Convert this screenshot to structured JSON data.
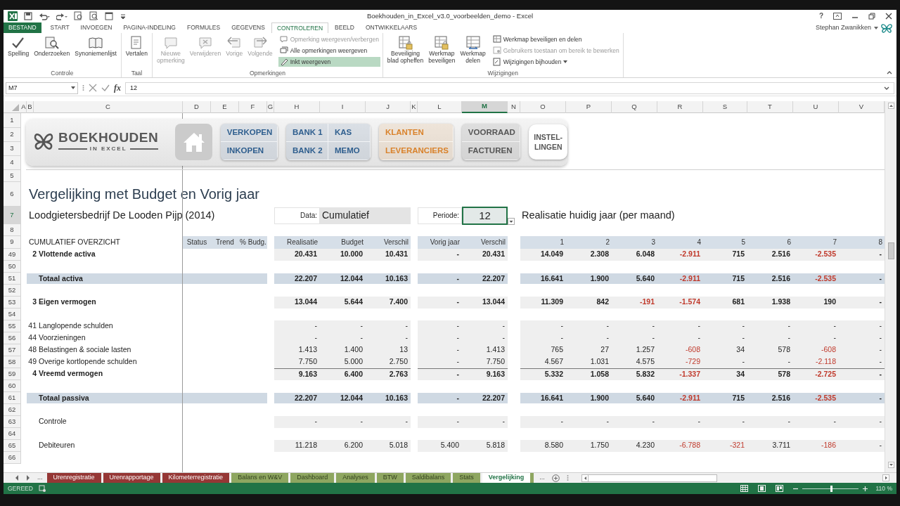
{
  "window": {
    "title": "Boekhouden_in_Excel_v3.0_voorbeelden_demo - Excel",
    "help": "?",
    "user": "Stephan Zwanikken"
  },
  "ribbon_tabs": [
    {
      "label": "BESTAND",
      "kind": "file",
      "selected": false
    },
    {
      "label": "START",
      "kind": "tab",
      "selected": false
    },
    {
      "label": "INVOEGEN",
      "kind": "tab",
      "selected": false
    },
    {
      "label": "PAGINA-INDELING",
      "kind": "tab",
      "selected": false
    },
    {
      "label": "FORMULES",
      "kind": "tab",
      "selected": false
    },
    {
      "label": "GEGEVENS",
      "kind": "tab",
      "selected": false
    },
    {
      "label": "CONTROLEREN",
      "kind": "tab",
      "selected": true
    },
    {
      "label": "BEELD",
      "kind": "tab",
      "selected": false
    },
    {
      "label": "ONTWIKKELAARS",
      "kind": "tab",
      "selected": false
    }
  ],
  "ribbon_groups": [
    {
      "label": "Controle",
      "commands": [
        {
          "label": "Spelling",
          "kind": "large",
          "disabled": false,
          "on": false,
          "dropdown": false
        },
        {
          "label": "Onderzoeken",
          "kind": "large",
          "disabled": false,
          "on": false,
          "dropdown": false
        },
        {
          "label": "Synoniemenlijst",
          "kind": "large",
          "disabled": false,
          "on": false,
          "dropdown": false
        }
      ]
    },
    {
      "label": "Taal",
      "commands": [
        {
          "label": "Vertalen",
          "kind": "large",
          "disabled": false,
          "on": false,
          "dropdown": false
        }
      ]
    },
    {
      "label": "Opmerkingen",
      "commands": [
        {
          "label": "Nieuwe\nopmerking",
          "kind": "large",
          "disabled": true,
          "on": false,
          "dropdown": false
        },
        {
          "label": "Verwijderen",
          "kind": "large",
          "disabled": true,
          "on": false,
          "dropdown": false
        },
        {
          "label": "Vorige",
          "kind": "large",
          "disabled": true,
          "on": false,
          "dropdown": false
        },
        {
          "label": "Volgende",
          "kind": "large",
          "disabled": true,
          "on": false,
          "dropdown": false
        },
        {
          "label": "Opmerking weergeven/verbergen",
          "kind": "small",
          "disabled": true,
          "on": false,
          "dropdown": false
        },
        {
          "label": "Alle opmerkingen weergeven",
          "kind": "small",
          "disabled": false,
          "on": false,
          "dropdown": false
        },
        {
          "label": "Inkt weergeven",
          "kind": "small",
          "disabled": false,
          "on": true,
          "dropdown": false
        }
      ]
    },
    {
      "label": "Wijzigingen",
      "commands": [
        {
          "label": "Beveiliging\nblad opheffen",
          "kind": "large",
          "disabled": false,
          "on": false,
          "dropdown": false
        },
        {
          "label": "Werkmap\nbeveiligen",
          "kind": "large",
          "disabled": false,
          "on": false,
          "dropdown": false
        },
        {
          "label": "Werkmap\ndelen",
          "kind": "large",
          "disabled": false,
          "on": false,
          "dropdown": false
        },
        {
          "label": "Werkmap beveiligen en delen",
          "kind": "small",
          "disabled": false,
          "on": false,
          "dropdown": false
        },
        {
          "label": "Gebruikers toestaan om bereik te bewerken",
          "kind": "small",
          "disabled": true,
          "on": false,
          "dropdown": false
        },
        {
          "label": "Wijzigingen bijhouden",
          "kind": "small",
          "disabled": false,
          "on": false,
          "dropdown": true
        }
      ]
    }
  ],
  "formula_bar": {
    "name_box": "M7",
    "function_label": "fx",
    "formula": "12"
  },
  "columns": [
    {
      "label": "A",
      "selected": false
    },
    {
      "label": "B",
      "selected": false
    },
    {
      "label": "C",
      "selected": false
    },
    {
      "label": "D",
      "selected": false
    },
    {
      "label": "E",
      "selected": false
    },
    {
      "label": "F",
      "selected": false
    },
    {
      "label": "G",
      "selected": false
    },
    {
      "label": "H",
      "selected": false
    },
    {
      "label": "I",
      "selected": false
    },
    {
      "label": "J",
      "selected": false
    },
    {
      "label": "K",
      "selected": false
    },
    {
      "label": "L",
      "selected": false
    },
    {
      "label": "M",
      "selected": true
    },
    {
      "label": "N",
      "selected": false
    },
    {
      "label": "O",
      "selected": false
    },
    {
      "label": "P",
      "selected": false
    },
    {
      "label": "Q",
      "selected": false
    },
    {
      "label": "R",
      "selected": false
    },
    {
      "label": "S",
      "selected": false
    },
    {
      "label": "T",
      "selected": false
    },
    {
      "label": "U",
      "selected": false
    },
    {
      "label": "V",
      "selected": false
    }
  ],
  "top_rows": [
    {
      "number": "1",
      "selected": false
    },
    {
      "number": "2",
      "selected": false
    },
    {
      "number": "3",
      "selected": false
    },
    {
      "number": "4",
      "selected": false
    },
    {
      "number": "5",
      "selected": false
    },
    {
      "number": "6",
      "selected": false
    },
    {
      "number": "7",
      "selected": true
    },
    {
      "number": "8",
      "selected": false
    },
    {
      "number": "9",
      "selected": false
    }
  ],
  "dashboard": {
    "logo": {
      "title": "BOEKHOUDEN",
      "subtitle": "IN EXCEL"
    },
    "nav_groups": [
      {
        "kind": "home"
      },
      {
        "kind": "pair",
        "color": "#2e5e8e",
        "buttons": [
          "VERKOPEN",
          "INKOPEN"
        ]
      },
      {
        "kind": "pair",
        "color": "#2e5e8e",
        "buttons": [
          "BANK 1",
          "KAS",
          "BANK 2",
          "MEMO"
        ]
      },
      {
        "kind": "pair",
        "color": "#d9822b",
        "buttons": [
          "KLANTEN",
          "LEVERANCIERS"
        ]
      },
      {
        "kind": "pair",
        "color": "#555555",
        "buttons": [
          "VOORRAAD",
          "FACTUREN"
        ]
      },
      {
        "kind": "single",
        "color": "#555555",
        "buttons": [
          "INSTEL-LINGEN"
        ]
      }
    ]
  },
  "sheet": {
    "title": "Vergelijking met Budget en Vorig jaar",
    "company": "Loodgietersbedrijf De Looden Pijp (2014)",
    "data_label": "Data:",
    "data_value": "Cumulatief",
    "period_label": "Periode:",
    "period_value": "12",
    "monthly_title": "Realisatie huidig jaar (per maand)"
  },
  "overview": {
    "title": "CUMULATIEF OVERZICHT",
    "columns": [
      "Status",
      "Trend",
      "% Budg.",
      "Realisatie",
      "Budget",
      "Verschil",
      "Vorig jaar",
      "Verschil",
      "1",
      "2",
      "3",
      "4",
      "5",
      "6",
      "7",
      "8"
    ]
  },
  "rows": [
    {
      "number": "49",
      "selected": false,
      "kind": "section",
      "code": "2",
      "label": "Vlottende activa",
      "values": [
        {
          "t": "20.431",
          "neg": false
        },
        {
          "t": "10.000",
          "neg": false
        },
        {
          "t": "10.431",
          "neg": false
        },
        {
          "t": "-",
          "neg": false
        },
        {
          "t": "20.431",
          "neg": false
        },
        {
          "t": "14.049",
          "neg": false
        },
        {
          "t": "2.308",
          "neg": false
        },
        {
          "t": "6.048",
          "neg": false
        },
        {
          "t": "-2.911",
          "neg": true
        },
        {
          "t": "715",
          "neg": false
        },
        {
          "t": "2.516",
          "neg": false
        },
        {
          "t": "-2.535",
          "neg": true
        },
        {
          "t": "-",
          "neg": false
        }
      ]
    },
    {
      "number": "50",
      "selected": false,
      "kind": "blank"
    },
    {
      "number": "51",
      "selected": false,
      "kind": "total",
      "label": "Totaal activa",
      "values": [
        {
          "t": "22.207",
          "neg": false
        },
        {
          "t": "12.044",
          "neg": false
        },
        {
          "t": "10.163",
          "neg": false
        },
        {
          "t": "-",
          "neg": false
        },
        {
          "t": "22.207",
          "neg": false
        },
        {
          "t": "16.641",
          "neg": false
        },
        {
          "t": "1.900",
          "neg": false
        },
        {
          "t": "5.640",
          "neg": false
        },
        {
          "t": "-2.911",
          "neg": true
        },
        {
          "t": "715",
          "neg": false
        },
        {
          "t": "2.516",
          "neg": false
        },
        {
          "t": "-2.535",
          "neg": true
        },
        {
          "t": "-",
          "neg": false
        }
      ]
    },
    {
      "number": "52",
      "selected": false,
      "kind": "blank"
    },
    {
      "number": "53",
      "selected": false,
      "kind": "section",
      "code": "3",
      "label": "Eigen vermogen",
      "values": [
        {
          "t": "13.044",
          "neg": false
        },
        {
          "t": "5.644",
          "neg": false
        },
        {
          "t": "7.400",
          "neg": false
        },
        {
          "t": "-",
          "neg": false
        },
        {
          "t": "13.044",
          "neg": false
        },
        {
          "t": "11.309",
          "neg": false
        },
        {
          "t": "842",
          "neg": false
        },
        {
          "t": "-191",
          "neg": true
        },
        {
          "t": "-1.574",
          "neg": true
        },
        {
          "t": "681",
          "neg": false
        },
        {
          "t": "1.938",
          "neg": false
        },
        {
          "t": "190",
          "neg": false
        },
        {
          "t": "-",
          "neg": false
        }
      ]
    },
    {
      "number": "54",
      "selected": false,
      "kind": "blank"
    },
    {
      "number": "55",
      "selected": false,
      "kind": "detail",
      "code": "41",
      "label": "Langlopende schulden",
      "values": [
        {
          "t": "-",
          "neg": false
        },
        {
          "t": "-",
          "neg": false
        },
        {
          "t": "-",
          "neg": false
        },
        {
          "t": "-",
          "neg": false
        },
        {
          "t": "-",
          "neg": false
        },
        {
          "t": "-",
          "neg": false
        },
        {
          "t": "-",
          "neg": false
        },
        {
          "t": "-",
          "neg": false
        },
        {
          "t": "-",
          "neg": false
        },
        {
          "t": "-",
          "neg": false
        },
        {
          "t": "-",
          "neg": false
        },
        {
          "t": "-",
          "neg": false
        },
        {
          "t": "-",
          "neg": false
        }
      ]
    },
    {
      "number": "56",
      "selected": false,
      "kind": "detail",
      "code": "44",
      "label": "Voorzieningen",
      "values": [
        {
          "t": "-",
          "neg": false
        },
        {
          "t": "-",
          "neg": false
        },
        {
          "t": "-",
          "neg": false
        },
        {
          "t": "-",
          "neg": false
        },
        {
          "t": "-",
          "neg": false
        },
        {
          "t": "-",
          "neg": false
        },
        {
          "t": "-",
          "neg": false
        },
        {
          "t": "-",
          "neg": false
        },
        {
          "t": "-",
          "neg": false
        },
        {
          "t": "-",
          "neg": false
        },
        {
          "t": "-",
          "neg": false
        },
        {
          "t": "-",
          "neg": false
        },
        {
          "t": "-",
          "neg": false
        }
      ]
    },
    {
      "number": "57",
      "selected": false,
      "kind": "detail",
      "code": "48",
      "label": "Belastingen & sociale lasten",
      "values": [
        {
          "t": "1.413",
          "neg": false
        },
        {
          "t": "1.400",
          "neg": false
        },
        {
          "t": "13",
          "neg": false
        },
        {
          "t": "-",
          "neg": false
        },
        {
          "t": "1.413",
          "neg": false
        },
        {
          "t": "765",
          "neg": false
        },
        {
          "t": "27",
          "neg": false
        },
        {
          "t": "1.257",
          "neg": false
        },
        {
          "t": "-608",
          "neg": true
        },
        {
          "t": "34",
          "neg": false
        },
        {
          "t": "578",
          "neg": false
        },
        {
          "t": "-608",
          "neg": true
        },
        {
          "t": "-",
          "neg": false
        }
      ]
    },
    {
      "number": "58",
      "selected": false,
      "kind": "detail",
      "code": "49",
      "label": "Overige kortlopende schulden",
      "values": [
        {
          "t": "7.750",
          "neg": false
        },
        {
          "t": "5.000",
          "neg": false
        },
        {
          "t": "2.750",
          "neg": false
        },
        {
          "t": "-",
          "neg": false
        },
        {
          "t": "7.750",
          "neg": false
        },
        {
          "t": "4.567",
          "neg": false
        },
        {
          "t": "1.031",
          "neg": false
        },
        {
          "t": "4.575",
          "neg": false
        },
        {
          "t": "-729",
          "neg": true
        },
        {
          "t": "-",
          "neg": false
        },
        {
          "t": "-",
          "neg": false
        },
        {
          "t": "-2.118",
          "neg": true
        },
        {
          "t": "-",
          "neg": false
        }
      ]
    },
    {
      "number": "59",
      "selected": false,
      "kind": "subtotal",
      "code": "4",
      "label": "Vreemd vermogen",
      "values": [
        {
          "t": "9.163",
          "neg": false
        },
        {
          "t": "6.400",
          "neg": false
        },
        {
          "t": "2.763",
          "neg": false
        },
        {
          "t": "-",
          "neg": false
        },
        {
          "t": "9.163",
          "neg": false
        },
        {
          "t": "5.332",
          "neg": false
        },
        {
          "t": "1.058",
          "neg": false
        },
        {
          "t": "5.832",
          "neg": false
        },
        {
          "t": "-1.337",
          "neg": true
        },
        {
          "t": "34",
          "neg": false
        },
        {
          "t": "578",
          "neg": false
        },
        {
          "t": "-2.725",
          "neg": true
        },
        {
          "t": "-",
          "neg": false
        }
      ]
    },
    {
      "number": "60",
      "selected": false,
      "kind": "blank"
    },
    {
      "number": "61",
      "selected": false,
      "kind": "total",
      "label": "Totaal passiva",
      "values": [
        {
          "t": "22.207",
          "neg": false
        },
        {
          "t": "12.044",
          "neg": false
        },
        {
          "t": "10.163",
          "neg": false
        },
        {
          "t": "-",
          "neg": false
        },
        {
          "t": "22.207",
          "neg": false
        },
        {
          "t": "16.641",
          "neg": false
        },
        {
          "t": "1.900",
          "neg": false
        },
        {
          "t": "5.640",
          "neg": false
        },
        {
          "t": "-2.911",
          "neg": true
        },
        {
          "t": "715",
          "neg": false
        },
        {
          "t": "2.516",
          "neg": false
        },
        {
          "t": "-2.535",
          "neg": true
        },
        {
          "t": "-",
          "neg": false
        }
      ]
    },
    {
      "number": "62",
      "selected": false,
      "kind": "blank"
    },
    {
      "number": "63",
      "selected": false,
      "kind": "item",
      "label": "Controle",
      "values": [
        {
          "t": "-",
          "neg": false
        },
        {
          "t": "-",
          "neg": false
        },
        {
          "t": "-",
          "neg": false
        },
        {
          "t": "-",
          "neg": false
        },
        {
          "t": "-",
          "neg": false
        },
        {
          "t": "-",
          "neg": false
        },
        {
          "t": "-",
          "neg": false
        },
        {
          "t": "-",
          "neg": false
        },
        {
          "t": "-",
          "neg": false
        },
        {
          "t": "-",
          "neg": false
        },
        {
          "t": "-",
          "neg": false
        },
        {
          "t": "-",
          "neg": false
        },
        {
          "t": "-",
          "neg": false
        }
      ]
    },
    {
      "number": "64",
      "selected": false,
      "kind": "blank"
    },
    {
      "number": "65",
      "selected": false,
      "kind": "item",
      "label": "Debiteuren",
      "values": [
        {
          "t": "11.218",
          "neg": false
        },
        {
          "t": "6.200",
          "neg": false
        },
        {
          "t": "5.018",
          "neg": false
        },
        {
          "t": "5.400",
          "neg": false
        },
        {
          "t": "5.818",
          "neg": false
        },
        {
          "t": "8.580",
          "neg": false
        },
        {
          "t": "1.750",
          "neg": false
        },
        {
          "t": "4.230",
          "neg": false
        },
        {
          "t": "-6.788",
          "neg": true
        },
        {
          "t": "-321",
          "neg": true
        },
        {
          "t": "3.711",
          "neg": false
        },
        {
          "t": "-186",
          "neg": true
        },
        {
          "t": "-",
          "neg": false
        }
      ]
    },
    {
      "number": "66",
      "selected": false,
      "kind": "blank"
    }
  ],
  "sheet_tabs": {
    "more_left": "...",
    "more_right": "...",
    "tabs": [
      {
        "label": "Urenregistratie",
        "color": "#953735",
        "selected": false
      },
      {
        "label": "Urenrapportage",
        "color": "#953735",
        "selected": false
      },
      {
        "label": "Kilometerregistratie",
        "color": "#953735",
        "selected": false
      },
      {
        "label": "Balans en W&V",
        "color": "#8ea660",
        "selected": false
      },
      {
        "label": "Dashboard",
        "color": "#8ea660",
        "selected": false
      },
      {
        "label": "Analyses",
        "color": "#8ea660",
        "selected": false
      },
      {
        "label": "BTW",
        "color": "#8ea660",
        "selected": false
      },
      {
        "label": "Saldibalans",
        "color": "#8ea660",
        "selected": false
      },
      {
        "label": "Stats",
        "color": "#8ea660",
        "selected": false
      },
      {
        "label": "Vergelijking",
        "color": "#8ea660",
        "selected": true
      }
    ]
  },
  "status_bar": {
    "status": "GEREED",
    "zoom": "110 %",
    "zoom_slider": {
      "level": 0.52
    }
  }
}
